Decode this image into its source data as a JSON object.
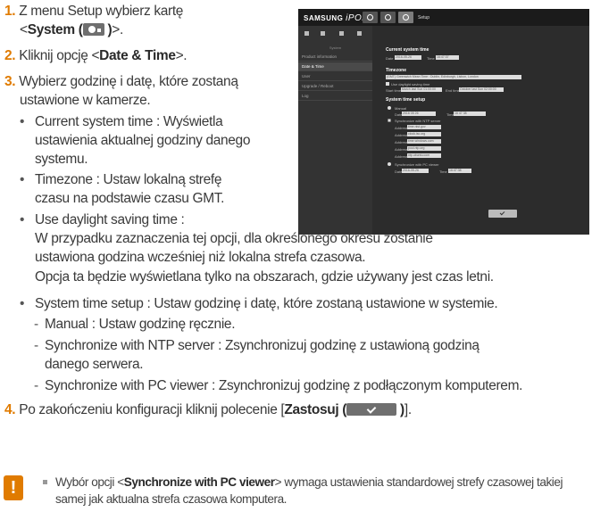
{
  "steps": {
    "s1_num": "1.",
    "s1_pre": "Z menu Setup wybierz kartę",
    "s1_open": "<",
    "s1_bold": "System (",
    "s1_bold_close": " )",
    "s1_end": ">.",
    "s2_num": "2.",
    "s2_pre": "Kliknij opcję <",
    "s2_bold": "Date & Time",
    "s2_end": ">.",
    "s3_num": "3.",
    "s3_line1": "Wybierz godzinę i datę, które zostaną",
    "s3_line2": "ustawione w kamerze.",
    "s4_num": "4.",
    "s4_pre": "Po zakończeniu konfiguracji kliknij polecenie [",
    "s4_bold": "Zastosuj (",
    "s4_bold_close": " )",
    "s4_end": "]."
  },
  "bullets": {
    "current_1": "Current system time : Wyświetla",
    "current_2": "ustawienia aktualnej godziny danego",
    "current_3": "systemu.",
    "timezone_1": "Timezone : Ustaw lokalną strefę",
    "timezone_2": "czasu na podstawie czasu GMT.",
    "dst_1": "Use daylight saving time :",
    "dst_2": "W przypadku zaznaczenia tej opcji, dla określonego okresu zostanie",
    "dst_3": "ustawiona godzina wcześniej niż lokalna strefa czasowa.",
    "dst_4": "Opcja ta będzie wyświetlana tylko na obszarach, gdzie używany jest czas letni.",
    "setup": "System time setup : Ustaw godzinę i datę, które zostaną ustawione w systemie.",
    "manual": "Manual : Ustaw godzinę ręcznie.",
    "ntp_1": "Synchronize with NTP server : Zsynchronizuj godzinę z ustawioną godziną",
    "ntp_2": "danego serwera.",
    "pc": "Synchronize with PC viewer : Zsynchronizuj godzinę z podłączonym komputerem."
  },
  "note": {
    "icon": "!",
    "pre": "Wybór opcji <",
    "bold": "Synchronize with PC viewer",
    "post": "> wymaga ustawienia standardowej strefy czasowej takiej samej jak aktualna strefa czasowa komputera."
  },
  "screenshot": {
    "brand": "SAMSUNG",
    "logo": "iPOLiS",
    "setup": "Setup",
    "side_head": "System",
    "side_items": [
      "Product information",
      "Date & Time",
      "User",
      "Upgrade / Reboot",
      "Log"
    ],
    "sec_current": "Current system time",
    "lbl_date": "Date",
    "val_date": "2016-05-26",
    "lbl_time": "Time",
    "val_time": "16:47:37",
    "sec_timezone": "Timezone",
    "val_timezone": "(GMT) Greenwich Mean Time : Dublin, Edinburgh, Lisbon, London",
    "dst_label": "Use daylight saving time",
    "lbl_start": "Start time",
    "val_start": "March last Sun 01:00:00",
    "lbl_end": "End time",
    "val_end": "October last Sun 02:00:00",
    "sec_setup": "System time setup",
    "manual": "Manual",
    "val_m_date": "2016 05 26",
    "val_m_time": "16 47 38",
    "ntp": "Synchronize with NTP server",
    "addr_label": "Address",
    "ntp_addr": [
      "time.nist.gov",
      "clock.isc.org",
      "time.windows.com",
      "pool.ntp.org",
      "ntp.ubuntu.com"
    ],
    "pc": "Synchronize with PC viewer",
    "val_pc_date": "2016-05-26",
    "val_pc_time": "16:47:38"
  }
}
